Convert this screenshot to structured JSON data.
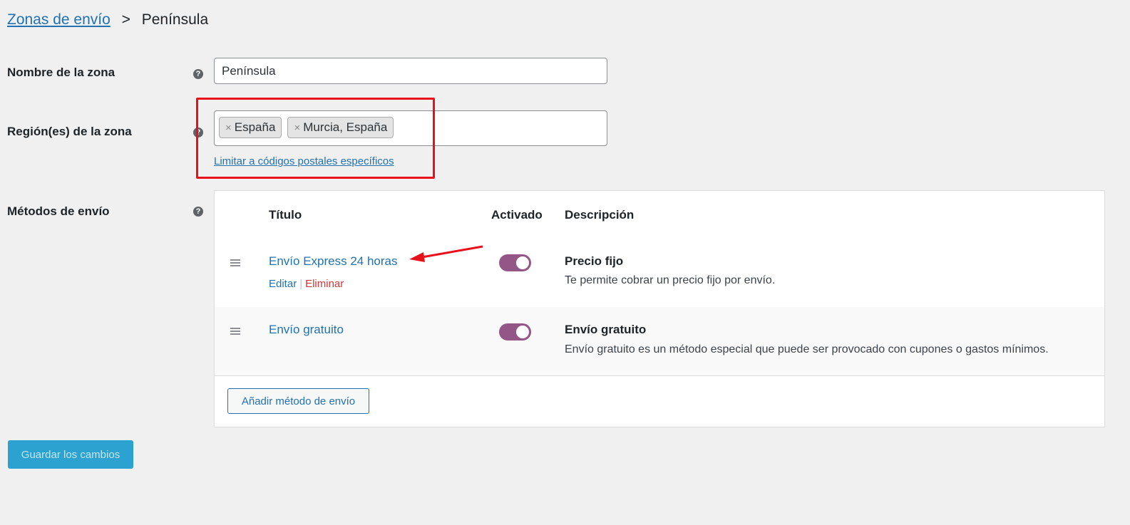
{
  "breadcrumb": {
    "parent": "Zonas de envío",
    "separator": ">",
    "current": "Península"
  },
  "form": {
    "zone_name_label": "Nombre de la zona",
    "zone_name_value": "Península",
    "regions_label": "Región(es) de la zona",
    "regions": [
      {
        "remove": "×",
        "label": "España"
      },
      {
        "remove": "×",
        "label": "Murcia, España"
      }
    ],
    "postcode_link": "Limitar a códigos postales específicos",
    "methods_label": "Métodos de envío",
    "help_glyph": "?"
  },
  "methods_table": {
    "headers": {
      "title": "Título",
      "enabled": "Activado",
      "description": "Descripción"
    },
    "rows": [
      {
        "title": "Envío Express 24 horas",
        "edit": "Editar",
        "separator": "|",
        "delete": "Eliminar",
        "enabled": true,
        "desc_title": "Precio fijo",
        "desc_text": "Te permite cobrar un precio fijo por envío."
      },
      {
        "title": "Envío gratuito",
        "enabled": true,
        "desc_title": "Envío gratuito",
        "desc_text": "Envío gratuito es un método especial que puede ser provocado con cupones o gastos mínimos."
      }
    ],
    "add_button": "Añadir método de envío"
  },
  "save_button": "Guardar los cambios",
  "colors": {
    "link": "#2271b1",
    "toggle_on": "#935687",
    "delete": "#d63638",
    "annotation": "#e8101a",
    "save_bg": "#2ba2cf"
  }
}
